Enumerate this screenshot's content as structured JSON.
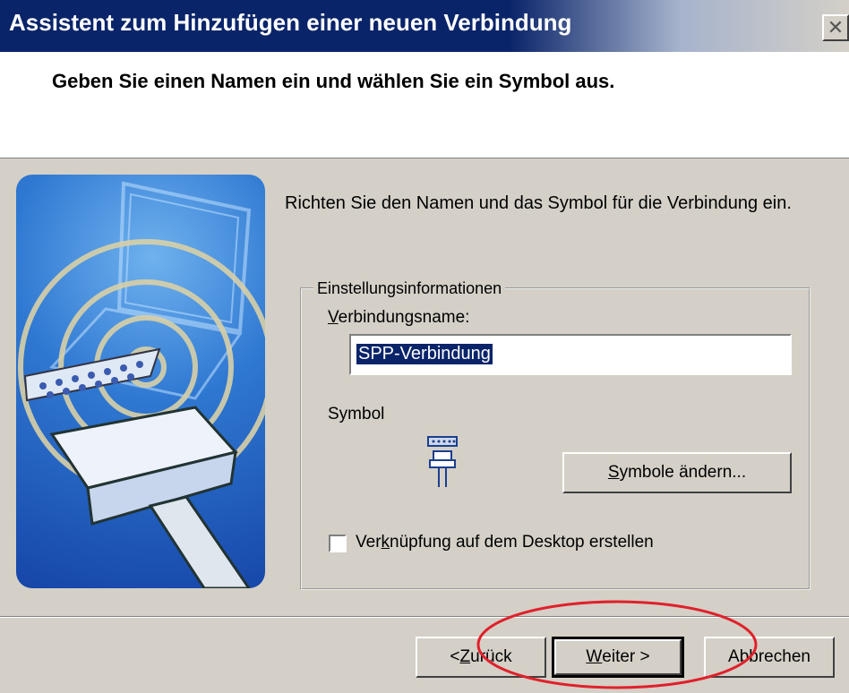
{
  "window": {
    "title": "Assistent zum Hinzufügen einer neuen Verbindung",
    "close_glyph": "✕"
  },
  "header": {
    "headline": "Geben Sie einen Namen ein und wählen Sie ein Symbol aus."
  },
  "main": {
    "intro": "Richten Sie den Namen und das Symbol für die Verbindung ein.",
    "group_title": "Einstellungsinformationen",
    "connection_name_label": {
      "accesskey": "V",
      "rest": "erbindungsname:"
    },
    "connection_name_value": "SPP-Verbindung",
    "symbol_label": "Symbol",
    "change_symbol_button": {
      "accesskey": "S",
      "rest": "ymbole ändern..."
    },
    "shortcut_checkbox": {
      "checked": false,
      "before": "Ver",
      "accesskey": "k",
      "rest": "nüpfung auf dem Desktop erstellen"
    }
  },
  "footer": {
    "back_button": {
      "before": "< ",
      "accesskey": "Z",
      "rest": "urück"
    },
    "next_button": {
      "accesskey": "W",
      "rest": "eiter >"
    },
    "cancel_button": "Abbrechen"
  },
  "colors": {
    "titlebar": "#0a246a",
    "dialog_bg": "#d4d0c8",
    "annotation_circle": "#e0202a"
  },
  "icons": {
    "left_art": "bluetooth-connection-illustration",
    "symbol_preview": "serial-port-connector-icon"
  }
}
